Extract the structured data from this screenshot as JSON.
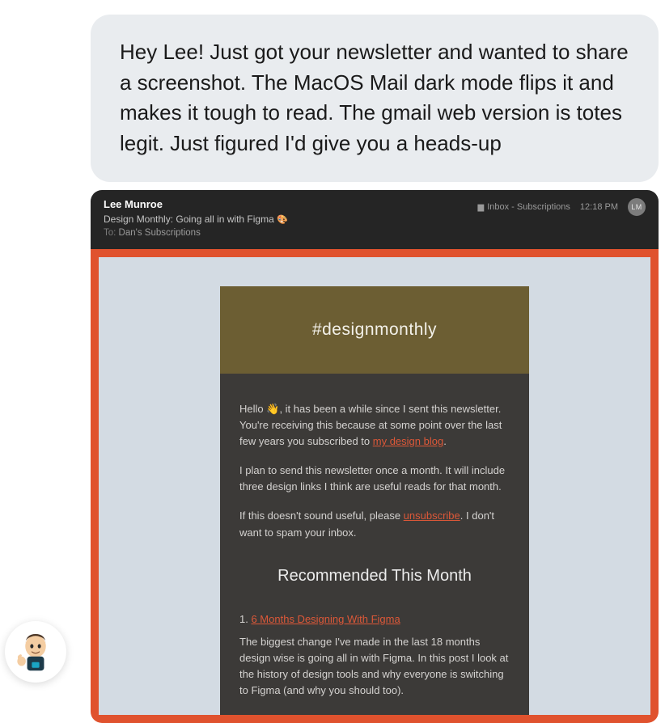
{
  "chat": {
    "message": "Hey Lee! Just got your newsletter and wanted to share a screenshot. The MacOS Mail dark mode flips it and makes it tough to read. The gmail web version is totes legit. Just figured I'd give you a heads-up"
  },
  "mail": {
    "from": "Lee Munroe",
    "subject_prefix": "Design Monthly: Going all in with Figma ",
    "subject_emoji": "🎨",
    "to_label": "To: ",
    "to_value": "Dan's Subscriptions",
    "folder_label": "Inbox - Subscriptions",
    "time": "12:18 PM",
    "avatar_initials": "LM"
  },
  "newsletter": {
    "hashtag": "#designmonthly",
    "intro_pre": "Hello ",
    "intro_wave": "👋",
    "intro_post": ", it has been a while since I sent this newsletter. You're receiving this because at some point over the last few years you subscribed to ",
    "intro_link": "my design blog",
    "intro_end": ".",
    "plan": "I plan to send this newsletter once a month. It will include three design links I think are useful reads for that month.",
    "unsub_pre": "If this doesn't sound useful, please ",
    "unsub_link": "unsubscribe",
    "unsub_post": ". I don't want to spam your inbox.",
    "section_title": "Recommended This Month",
    "item1_num": "1. ",
    "item1_title": "6 Months Designing With Figma",
    "item1_desc": "The biggest change I've made in the last 18 months design wise is going all in with Figma. In this post I look at the history of design tools and why everyone is switching to Figma (and why you should too)."
  }
}
